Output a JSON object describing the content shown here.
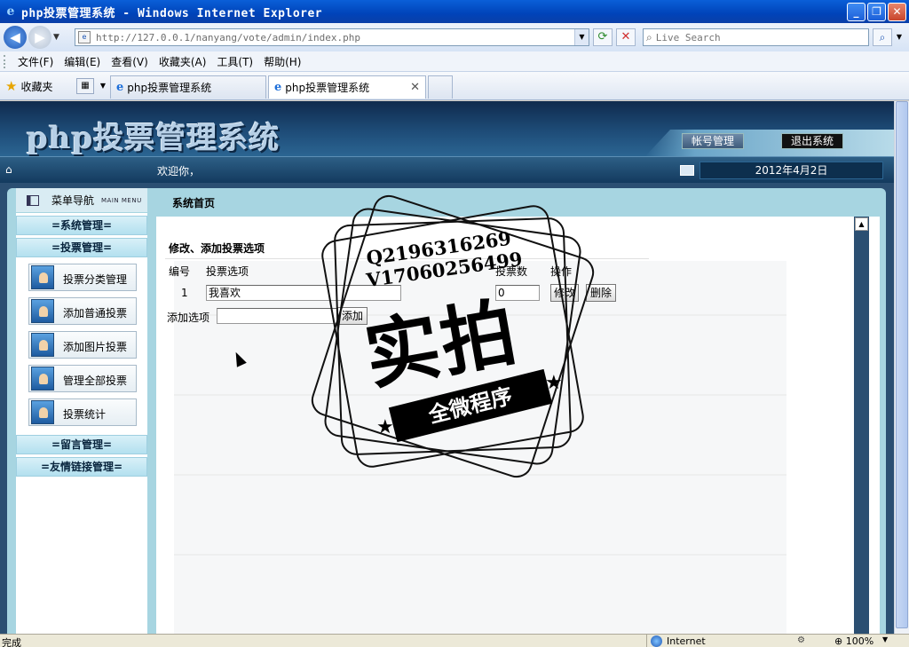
{
  "window": {
    "title": "php投票管理系统 - Windows Internet Explorer",
    "icon": "ie-icon",
    "buttons": {
      "minimize": "_",
      "maximize": "❐",
      "close": "✕"
    }
  },
  "address_bar": {
    "url": "http://127.0.0.1/nanyang/vote/admin/index.php",
    "search_placeholder": "Live Search"
  },
  "menu": [
    "文件(F)",
    "编辑(E)",
    "查看(V)",
    "收藏夹(A)",
    "工具(T)",
    "帮助(H)"
  ],
  "favorites_label": "收藏夹",
  "tabs": [
    {
      "label": "php投票管理系统"
    },
    {
      "label": "php投票管理系统",
      "active": true
    }
  ],
  "app": {
    "logo": "php投票管理系统",
    "account_button": "帐号管理",
    "logout_button": "退出系统",
    "welcome": "欢迎你，",
    "date": "2012年4月2日"
  },
  "sidebar": {
    "title": "菜单导航",
    "subtitle": "MAIN MENU",
    "groups": [
      "=系统管理=",
      "=投票管理=",
      "=留言管理=",
      "=友情链接管理="
    ],
    "items": [
      "投票分类管理",
      "添加普通投票",
      "添加图片投票",
      "管理全部投票",
      "投票统计"
    ]
  },
  "main": {
    "breadcrumb": "系统首页",
    "form": {
      "heading": "修改、添加投票选项",
      "columns": {
        "id": "编号",
        "option": "投票选项",
        "votes": "投票数",
        "action": "操作"
      },
      "rows": [
        {
          "id": "1",
          "option": "我喜欢",
          "votes": "0",
          "edit": "修改",
          "delete": "删除"
        }
      ],
      "add_label": "添加选项",
      "add_value": "",
      "add_button": "添加"
    }
  },
  "watermark": {
    "line1": "Q2196316269",
    "line2": "V17060256499",
    "main": "实拍",
    "banner": "全微程序"
  },
  "status_bar": {
    "text": "完成",
    "zone": "Internet",
    "zoom": "100%"
  }
}
